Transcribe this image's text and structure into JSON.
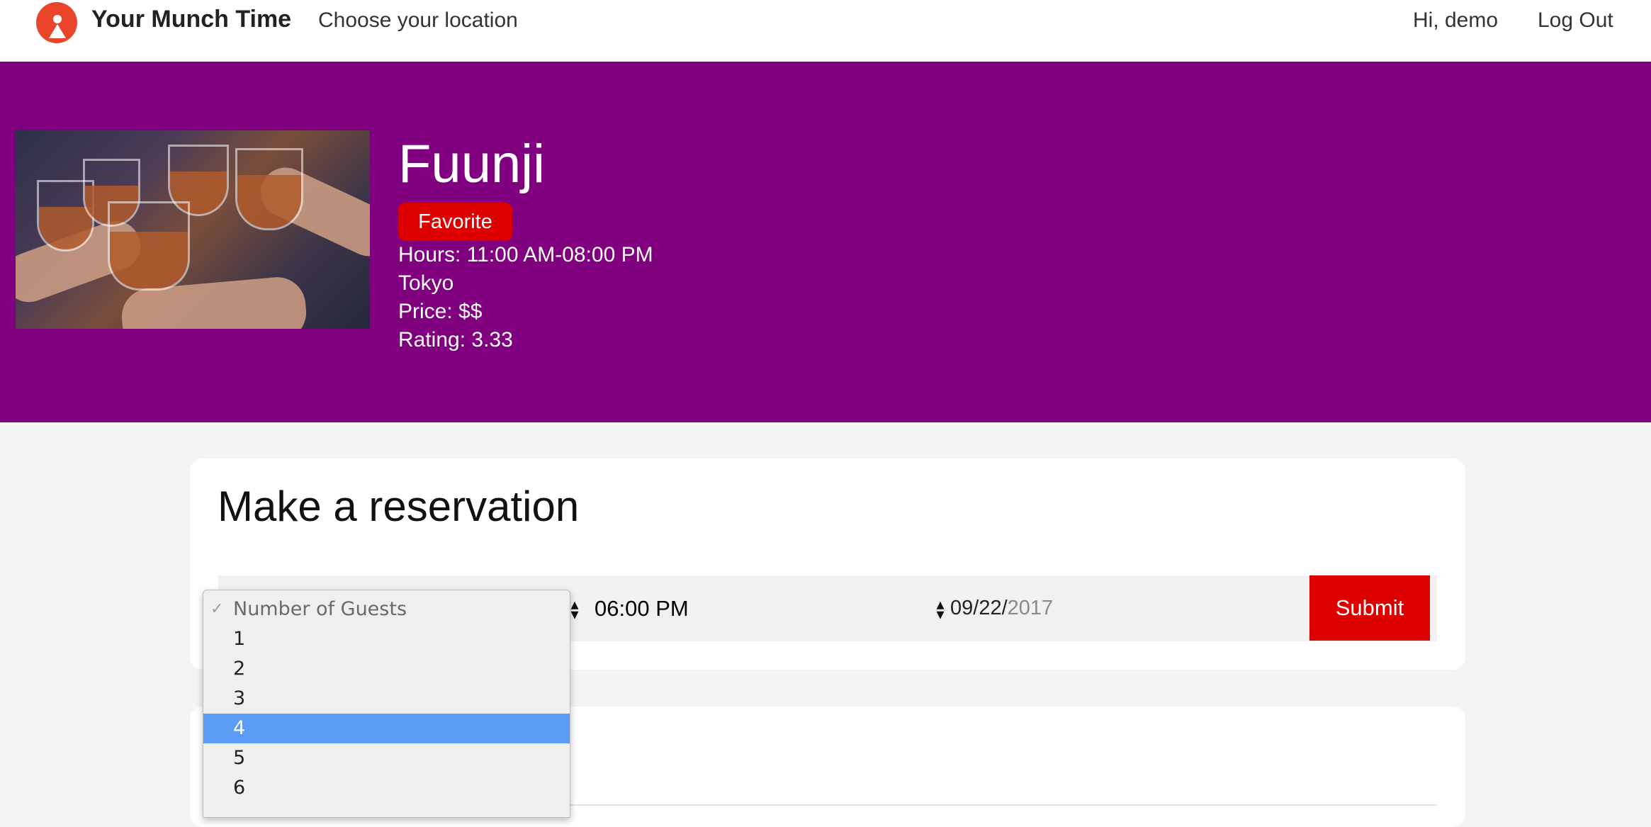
{
  "nav": {
    "brand": "Your Munch Time",
    "location_link": "Choose your location",
    "greeting": "Hi, demo",
    "logout": "Log Out"
  },
  "restaurant": {
    "name": "Fuunji",
    "favorite_label": "Favorite",
    "hours": "Hours: 11:00 AM-08:00 PM",
    "city": "Tokyo",
    "price": "Price: $$",
    "rating": "Rating: 3.33"
  },
  "reservation": {
    "title": "Make a reservation",
    "time_value": "06:00 PM",
    "date_value_month_day": "09/22/",
    "date_value_year": "2017",
    "submit_label": "Submit",
    "guests_dropdown": {
      "placeholder": "Number of Guests",
      "options": [
        "1",
        "2",
        "3",
        "4",
        "5",
        "6"
      ],
      "highlighted": "4"
    }
  },
  "colors": {
    "hero_bg": "#800080",
    "accent_red": "#dd0000",
    "logo": "#e8452b",
    "selection": "#5c9bf5"
  },
  "icons": [
    "logo-icon",
    "checkmark-icon",
    "spinner-arrows-icon"
  ]
}
